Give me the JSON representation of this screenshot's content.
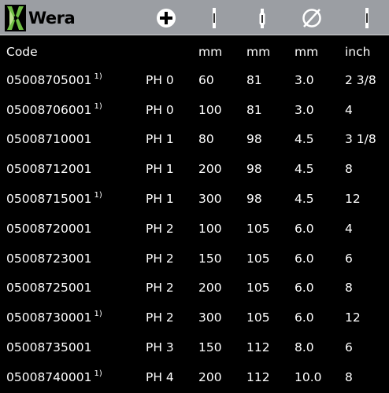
{
  "brand": {
    "name": "Wera"
  },
  "header_icons": [
    "plus-tip-icon",
    "blade-length-icon",
    "screwdriver-length-icon",
    "diameter-icon",
    "inch-length-icon"
  ],
  "columns": {
    "code": "Code",
    "type": "",
    "blade_length": "mm",
    "total_length": "mm",
    "diameter": "mm",
    "inch": "inch"
  },
  "rows": [
    {
      "code": "05008705001",
      "note": "1)",
      "type": "PH 0",
      "blade_length": "60",
      "total_length": "81",
      "diameter": "3.0",
      "inch": "2 3/8"
    },
    {
      "code": "05008706001",
      "note": "1)",
      "type": "PH 0",
      "blade_length": "100",
      "total_length": "81",
      "diameter": "3.0",
      "inch": "4"
    },
    {
      "code": "05008710001",
      "note": "",
      "type": "PH 1",
      "blade_length": "80",
      "total_length": "98",
      "diameter": "4.5",
      "inch": "3 1/8"
    },
    {
      "code": "05008712001",
      "note": "",
      "type": "PH 1",
      "blade_length": "200",
      "total_length": "98",
      "diameter": "4.5",
      "inch": "8"
    },
    {
      "code": "05008715001",
      "note": "1)",
      "type": "PH 1",
      "blade_length": "300",
      "total_length": "98",
      "diameter": "4.5",
      "inch": "12"
    },
    {
      "code": "05008720001",
      "note": "",
      "type": "PH 2",
      "blade_length": "100",
      "total_length": "105",
      "diameter": "6.0",
      "inch": "4"
    },
    {
      "code": "05008723001",
      "note": "",
      "type": "PH 2",
      "blade_length": "150",
      "total_length": "105",
      "diameter": "6.0",
      "inch": "6"
    },
    {
      "code": "05008725001",
      "note": "",
      "type": "PH 2",
      "blade_length": "200",
      "total_length": "105",
      "diameter": "6.0",
      "inch": "8"
    },
    {
      "code": "05008730001",
      "note": "1)",
      "type": "PH 2",
      "blade_length": "300",
      "total_length": "105",
      "diameter": "6.0",
      "inch": "12"
    },
    {
      "code": "05008735001",
      "note": "",
      "type": "PH 3",
      "blade_length": "150",
      "total_length": "112",
      "diameter": "8.0",
      "inch": "6"
    },
    {
      "code": "05008740001",
      "note": "1)",
      "type": "PH 4",
      "blade_length": "200",
      "total_length": "112",
      "diameter": "10.0",
      "inch": "8"
    }
  ]
}
